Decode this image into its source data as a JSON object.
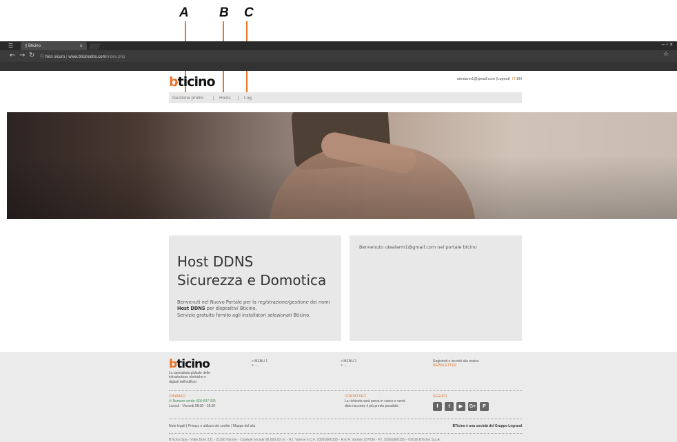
{
  "callouts": {
    "a": "A",
    "b": "B",
    "c": "C"
  },
  "browser": {
    "tab_title": "Bticino",
    "tab_close": "×",
    "security": "Non sicuro",
    "url_host": "www.bticinodns.com",
    "url_path": "/index.php",
    "window_controls": "– ▫ ×"
  },
  "header": {
    "user_email": "utealarm1@gmail.com",
    "logout": "(Logout)",
    "lang_it": "IT",
    "lang_en": "EN"
  },
  "nav": {
    "profile": "Gestione profilo",
    "hosts": "Hosts",
    "log": "Log",
    "sep": "|"
  },
  "intro": {
    "title_line1": "Host DDNS",
    "title_line2": "Sicurezza e Domotica",
    "desc_1": "Benvenuti nel Nuovo Portale per la ",
    "desc_em1": "registrazione/gestione",
    "desc_2": " dei nomi ",
    "desc_bold": "Host DDNS",
    "desc_3": " per dispositivi Bticino.",
    "desc_4": "Servizio gratuito fornito agli installatori ",
    "desc_em2": "selezionati",
    "desc_5": " Bticino."
  },
  "welcome": {
    "text": "Benvenuto utealarm1@gmail.com nel portale btcino"
  },
  "footer": {
    "tagline_1": "Lo specialista globale delle",
    "tagline_2": "infrastrutture elettriche e",
    "tagline_3": "digitali dell'edificio",
    "menu1": "> MENU 1",
    "menu1_sub": "> .....",
    "menu2": "> MENU 2",
    "menu2_sub": "> .....",
    "newsletter_pre": "Registrati e iscriviti alla nostra",
    "newsletter": "NEWSLETTER",
    "chiamaci": "CHIAMACI",
    "numero": "Numero verde: 800 837 035",
    "orari": "Lunedi - Venerdi 08:30 - 18:30",
    "contattaci": "CONTATTACI",
    "contatto_1": "La richiesta sarà presa in carico e verrà",
    "contatto_2": "date riscontro il più presto possibile",
    "seguici": "SEGUICI",
    "links": "Note legali  |  Privacy e utilizzo dei cookie  |  Mappa del sito",
    "group": "BTicino è una società del Gruppo Legrand",
    "legal": "BTicino Spa - Viale Borri 231 - 21100 Varese - Capitale sociale 98.800,00 i.v. - R.I. Varese e C.F. 10991860155 - R.E.A. Varese 237036 - P.I. 10991860155 - ©2016 BTicino S.p.A."
  },
  "social_icons": [
    "facebook-icon",
    "twitter-icon",
    "youtube-icon",
    "googleplus-icon",
    "pinterest-icon"
  ]
}
